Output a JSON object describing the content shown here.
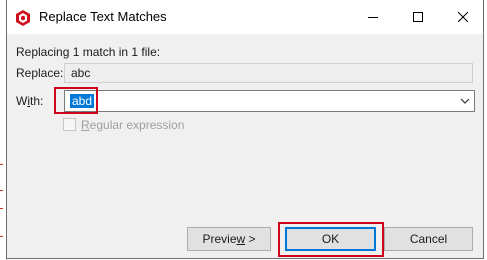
{
  "window": {
    "title": "Replace Text Matches",
    "accent_color": "#0078d7",
    "highlight_color": "#d0021b",
    "controls": [
      "minimize-icon",
      "maximize-icon",
      "close-icon"
    ]
  },
  "summary": "Replacing 1 match in 1 file:",
  "replace": {
    "label": "Replace:",
    "value": "abc"
  },
  "with": {
    "label_prefix": "W",
    "label_underlined": "i",
    "label_suffix": "th:",
    "value": "abd"
  },
  "regex": {
    "label_underlined": "R",
    "label_rest": "egular expression",
    "checked": false,
    "enabled": false
  },
  "buttons": {
    "preview_prefix": "Previe",
    "preview_underlined": "w",
    "preview_suffix": " >",
    "ok": "OK",
    "cancel": "Cancel"
  }
}
